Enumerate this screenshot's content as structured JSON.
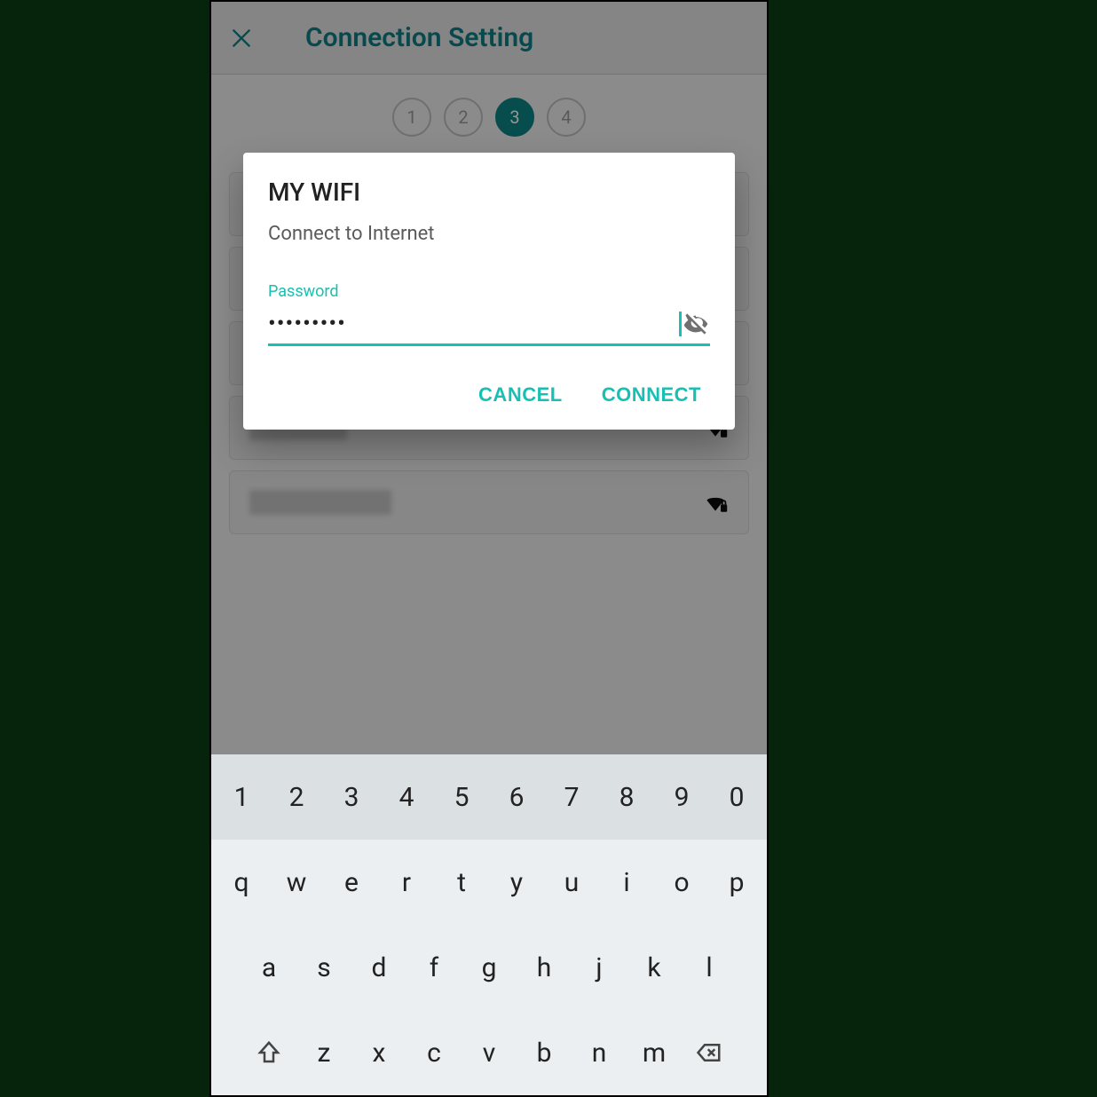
{
  "header": {
    "title": "Connection Setting"
  },
  "steps": {
    "items": [
      "1",
      "2",
      "3",
      "4"
    ],
    "active_index": 2
  },
  "dialog": {
    "title": "MY WIFI",
    "subtitle": "Connect to Internet",
    "password_label": "Password",
    "password_mask": "•••••••••",
    "cancel": "CANCEL",
    "connect": "CONNECT"
  },
  "keyboard": {
    "row1": [
      "1",
      "2",
      "3",
      "4",
      "5",
      "6",
      "7",
      "8",
      "9",
      "0"
    ],
    "row2": [
      "q",
      "w",
      "e",
      "r",
      "t",
      "y",
      "u",
      "i",
      "o",
      "p"
    ],
    "row3": [
      "a",
      "s",
      "d",
      "f",
      "g",
      "h",
      "j",
      "k",
      "l"
    ],
    "row4": [
      "z",
      "x",
      "c",
      "v",
      "b",
      "n",
      "m"
    ]
  }
}
